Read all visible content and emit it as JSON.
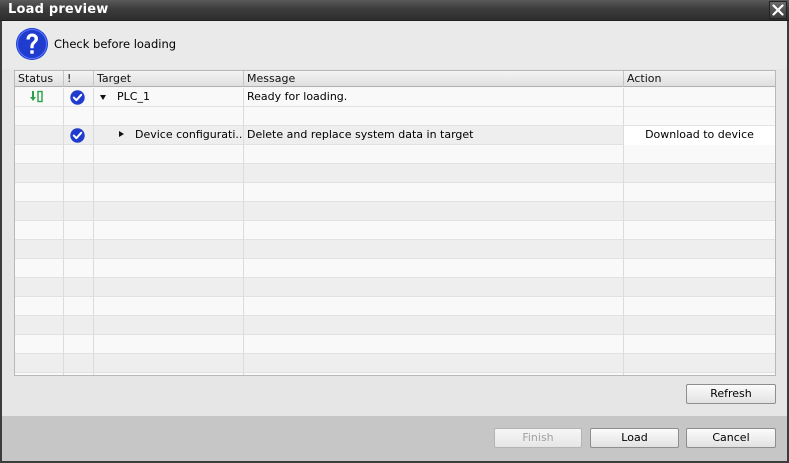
{
  "window": {
    "title": "Load preview"
  },
  "header": {
    "label": "Check before loading"
  },
  "table": {
    "columns": [
      "Status",
      "!",
      "Target",
      "Message",
      "Action"
    ],
    "rows": [
      {
        "target": "PLC_1",
        "message": "Ready for loading.",
        "action": ""
      },
      {
        "target": "",
        "message": "",
        "action": ""
      },
      {
        "target": "Device configurati...",
        "message": "Delete and replace system data in target",
        "action": "Download to device"
      }
    ]
  },
  "buttons": {
    "refresh": "Refresh",
    "finish": "Finish",
    "load": "Load",
    "cancel": "Cancel"
  },
  "colors": {
    "titlebar": "#3c3c3c",
    "check_icon": "#1f3ccf",
    "help_icon": "#1f3ccf",
    "status_icon": "#2aa14a"
  }
}
